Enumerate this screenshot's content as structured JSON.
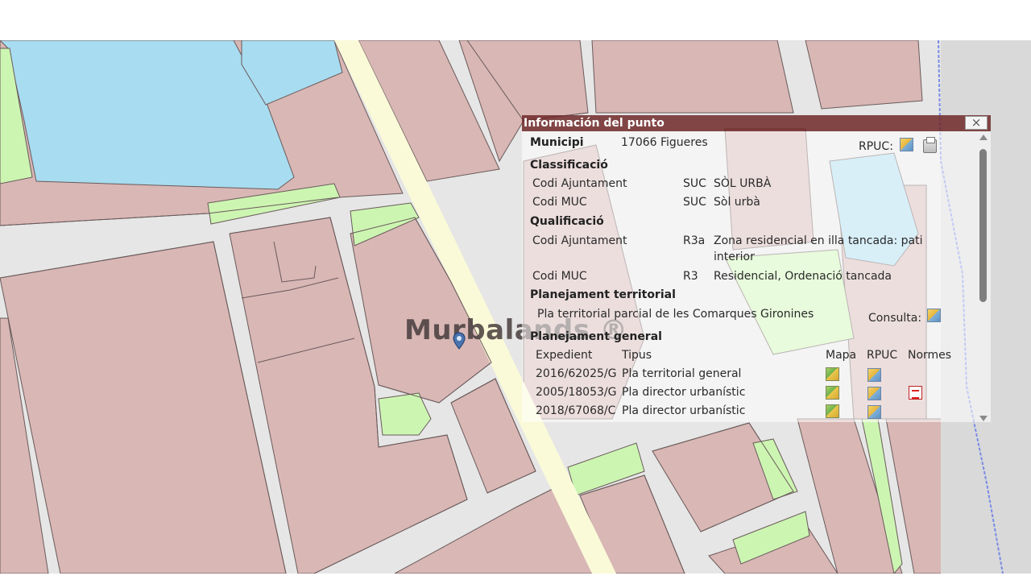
{
  "map": {
    "colors": {
      "parcel": "#d8b7b5",
      "street": "#e6e6e6",
      "water": "#a8dcf0",
      "green": "#ccf5b2",
      "main_road": "#fafad8",
      "boundary": "#7a8ce6",
      "border": "#6a5a5a"
    },
    "watermark": "Murbalands ®",
    "marker_icon": "location-pin-icon"
  },
  "popup": {
    "title": "Información del punto",
    "close_label": "×",
    "municipi_label": "Municipi",
    "municipi_value": "17066 Figueres",
    "rpuc_label": "RPUC:",
    "classificacio": {
      "title": "Classificació",
      "rows": [
        {
          "label": "Codi Ajuntament",
          "code": "SUC",
          "desc": "SÒL URBÀ"
        },
        {
          "label": "Codi MUC",
          "code": "SUC",
          "desc": "Sòl urbà"
        }
      ]
    },
    "qualificacio": {
      "title": "Qualificació",
      "rows": [
        {
          "label": "Codi Ajuntament",
          "code": "R3a",
          "desc": "Zona residencial en illa tancada: pati interior"
        },
        {
          "label": "Codi MUC",
          "code": "R3",
          "desc": "Residencial, Ordenació tancada"
        }
      ]
    },
    "planejament_territorial": {
      "title": "Planejament territorial",
      "plan": "Pla territorial parcial de les Comarques Gironines",
      "consulta_label": "Consulta:"
    },
    "planejament_general": {
      "title": "Planejament general",
      "headers": [
        "Expedient",
        "Tipus",
        "Mapa",
        "RPUC",
        "Normes"
      ],
      "rows": [
        {
          "expedient": "2016/62025/G",
          "tipus": "Pla territorial general"
        },
        {
          "expedient": "2005/18053/G",
          "tipus": "Pla director urbanístic"
        },
        {
          "expedient": "2018/67068/C",
          "tipus": "Pla director urbanístic"
        }
      ]
    }
  }
}
